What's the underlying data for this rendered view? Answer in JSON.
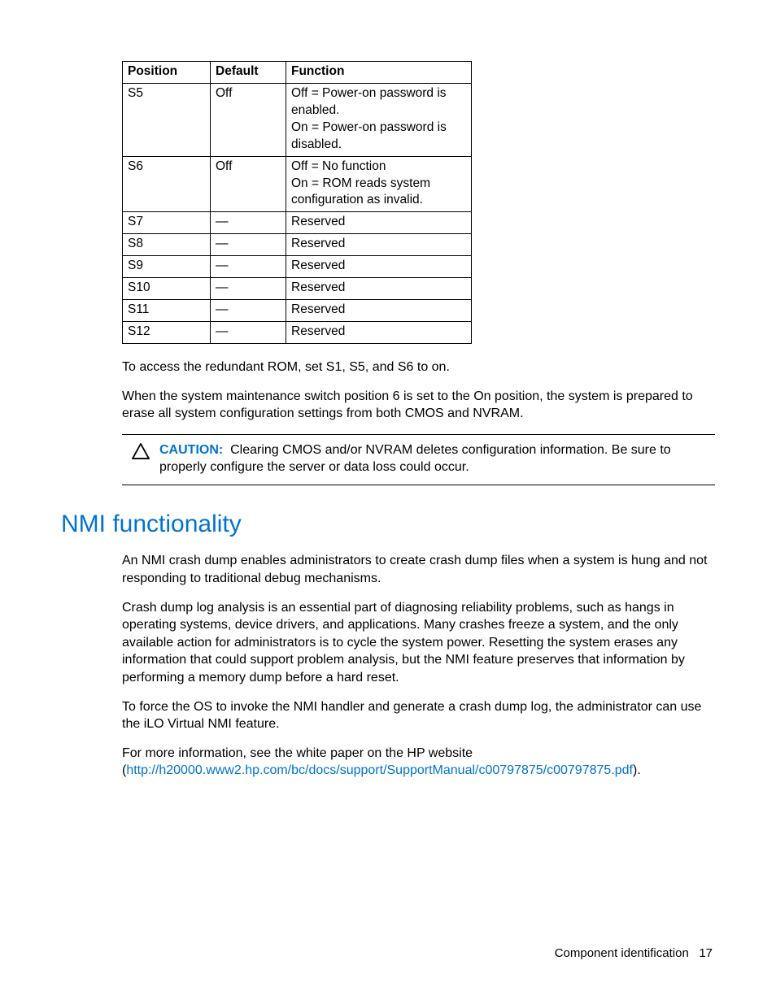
{
  "table": {
    "headers": {
      "position": "Position",
      "default": "Default",
      "function": "Function"
    },
    "rows": [
      {
        "position": "S5",
        "default": "Off",
        "function": "Off = Power-on password is enabled.\nOn = Power-on password is disabled."
      },
      {
        "position": "S6",
        "default": "Off",
        "function": "Off = No function\nOn = ROM reads system configuration as invalid."
      },
      {
        "position": "S7",
        "default": "—",
        "function": "Reserved"
      },
      {
        "position": "S8",
        "default": "—",
        "function": "Reserved"
      },
      {
        "position": "S9",
        "default": "—",
        "function": "Reserved"
      },
      {
        "position": "S10",
        "default": "—",
        "function": "Reserved"
      },
      {
        "position": "S11",
        "default": "—",
        "function": "Reserved"
      },
      {
        "position": "S12",
        "default": "—",
        "function": "Reserved"
      }
    ]
  },
  "para1": "To access the redundant ROM, set S1, S5, and S6 to on.",
  "para2": "When the system maintenance switch position 6 is set to the On position, the system is prepared to erase all system configuration settings from both CMOS and NVRAM.",
  "caution": {
    "label": "CAUTION:",
    "text": "Clearing CMOS and/or NVRAM deletes configuration information. Be sure to properly configure the server or data loss could occur."
  },
  "section_title": "NMI functionality",
  "nmi": {
    "p1": "An NMI crash dump enables administrators to create crash dump files when a system is hung and not responding to traditional debug mechanisms.",
    "p2": "Crash dump log analysis is an essential part of diagnosing reliability problems, such as hangs in operating systems, device drivers, and applications. Many crashes freeze a system, and the only available action for administrators is to cycle the system power. Resetting the system erases any information that could support problem analysis, but the NMI feature preserves that information by performing a memory dump before a hard reset.",
    "p3": "To force the OS to invoke the NMI handler and generate a crash dump log, the administrator can use the iLO Virtual NMI feature.",
    "p4_lead": "For more information, see the white paper on the HP website (",
    "p4_link": "http://h20000.www2.hp.com/bc/docs/support/SupportManual/c00797875/c00797875.pdf",
    "p4_tail": ")."
  },
  "footer": {
    "section": "Component identification",
    "page": "17"
  }
}
